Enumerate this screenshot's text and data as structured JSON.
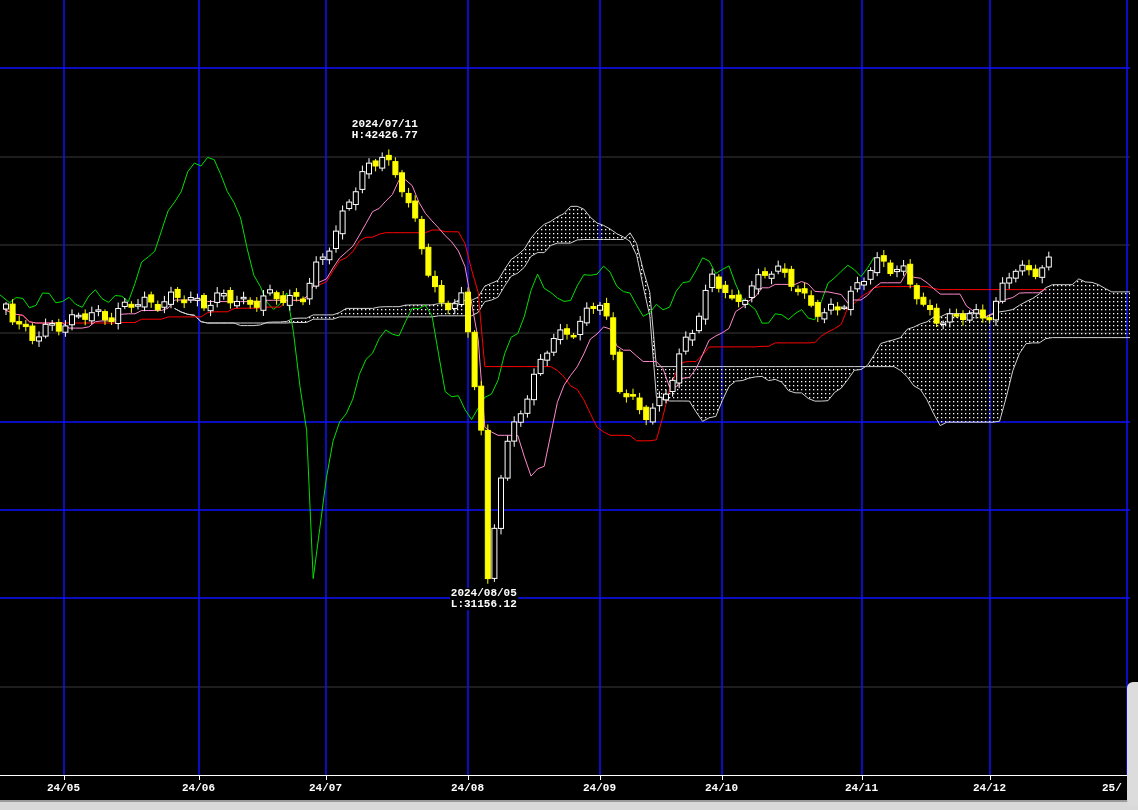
{
  "chart": {
    "x_labels": [
      "24/05",
      "24/06",
      "24/07",
      "24/08",
      "24/09",
      "24/10",
      "24/11",
      "24/12",
      "25/"
    ],
    "annotations": [
      {
        "kind": "high",
        "lines": [
          "2024/07/11",
          "H:42426.77"
        ]
      },
      {
        "kind": "low",
        "lines": [
          "2024/08/05",
          "L:31156.12"
        ]
      }
    ]
  }
}
